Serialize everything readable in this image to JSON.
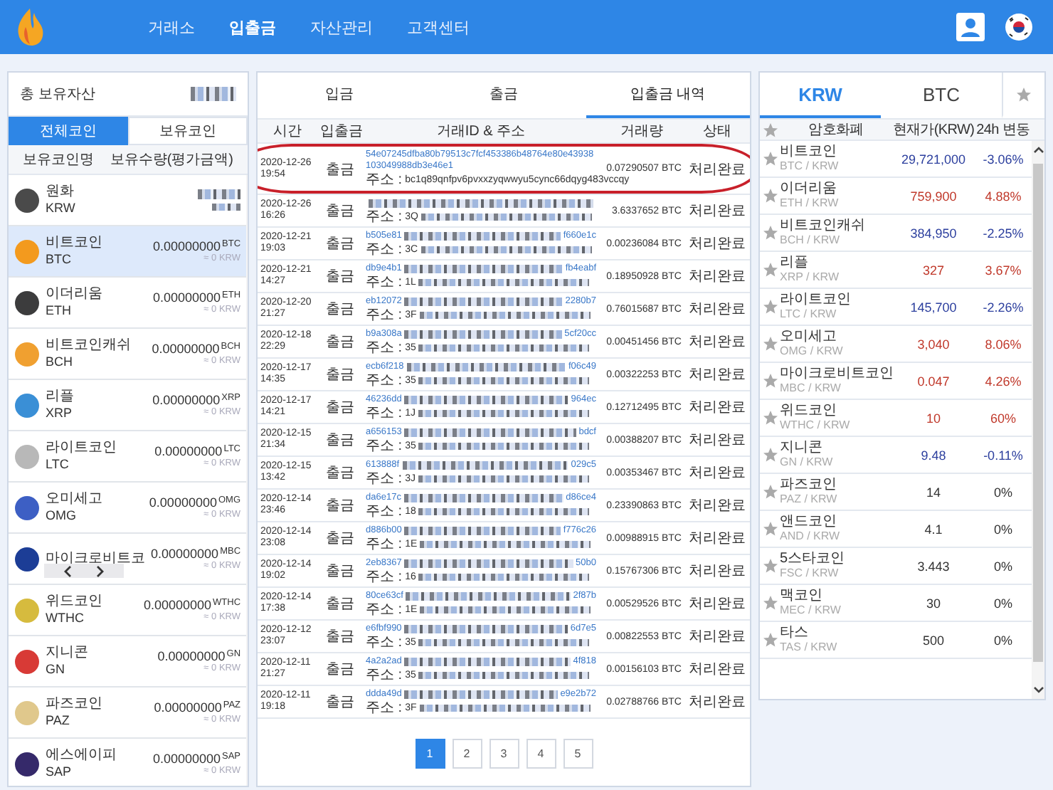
{
  "nav": {
    "items": [
      {
        "label": "거래소",
        "selected": false
      },
      {
        "label": "입출금",
        "selected": true
      },
      {
        "label": "자산관리",
        "selected": false
      },
      {
        "label": "고객센터",
        "selected": false
      }
    ]
  },
  "assets": {
    "title": "총 보유자산",
    "total_redacted": true,
    "tabs": [
      {
        "label": "전체코인",
        "selected": true
      },
      {
        "label": "보유코인",
        "selected": false
      }
    ],
    "columns": [
      "보유코인명",
      "보유수량(평가금액)"
    ],
    "coins": [
      {
        "name": "원화",
        "symbol": "KRW",
        "redacted": true,
        "selected": false,
        "color": "#4a4a4a"
      },
      {
        "name": "비트코인",
        "symbol": "BTC",
        "amount": "0.00000000",
        "unit": "BTC",
        "value": "≈ 0 KRW",
        "selected": true,
        "color": "#f39a1e"
      },
      {
        "name": "이더리움",
        "symbol": "ETH",
        "amount": "0.00000000",
        "unit": "ETH",
        "value": "≈ 0 KRW",
        "selected": false,
        "color": "#3c3c3d"
      },
      {
        "name": "비트코인캐쉬",
        "symbol": "BCH",
        "amount": "0.00000000",
        "unit": "BCH",
        "value": "≈ 0 KRW",
        "selected": false,
        "color": "#f0a030"
      },
      {
        "name": "리플",
        "symbol": "XRP",
        "amount": "0.00000000",
        "unit": "XRP",
        "value": "≈ 0 KRW",
        "selected": false,
        "color": "#3a8fd6"
      },
      {
        "name": "라이트코인",
        "symbol": "LTC",
        "amount": "0.00000000",
        "unit": "LTC",
        "value": "≈ 0 KRW",
        "selected": false,
        "color": "#b8b8b8"
      },
      {
        "name": "오미세고",
        "symbol": "OMG",
        "amount": "0.00000000",
        "unit": "OMG",
        "value": "≈ 0 KRW",
        "selected": false,
        "color": "#3d5fc4"
      },
      {
        "name": "마이크로비트코",
        "amount": "0.00000000",
        "unit": "MBC",
        "value": "≈ 0 KRW",
        "selected": false,
        "color": "#1c3d96",
        "popup": true
      },
      {
        "name": "위드코인",
        "symbol": "WTHC",
        "amount": "0.00000000",
        "unit": "WTHC",
        "value": "≈ 0 KRW",
        "selected": false,
        "color": "#d6bb3e"
      },
      {
        "name": "지니콘",
        "symbol": "GN",
        "amount": "0.00000000",
        "unit": "GN",
        "value": "≈ 0 KRW",
        "selected": false,
        "color": "#d83a36"
      },
      {
        "name": "파즈코인",
        "symbol": "PAZ",
        "amount": "0.00000000",
        "unit": "PAZ",
        "value": "≈ 0 KRW",
        "selected": false,
        "color": "#e0c88c"
      },
      {
        "name": "에스에이피",
        "symbol": "SAP",
        "amount": "0.00000000",
        "unit": "SAP",
        "value": "≈ 0 KRW",
        "selected": false,
        "color": "#35296a"
      }
    ]
  },
  "history": {
    "tabs": [
      {
        "label": "입금",
        "selected": false
      },
      {
        "label": "출금",
        "selected": false
      },
      {
        "label": "입출금 내역",
        "selected": true
      }
    ],
    "columns": [
      "시간",
      "입출금",
      "거래ID & 주소",
      "거래량",
      "상태"
    ],
    "rows": [
      {
        "date": "2020-12-26",
        "time": "19:54",
        "type": "출금",
        "txid": "54e07245dfba80b79513c7fcf453386b48764e80e43938103049988db3e46e1",
        "address_label": "주소 :",
        "address": "bc1q89qnfpv6pvxxzyqwwyu5cync66dqyg483vccqy",
        "amount": "0.07290507 BTC",
        "status": "처리완료",
        "redacted": false,
        "circled": true
      },
      {
        "date": "2020-12-26",
        "time": "16:26",
        "type": "출금",
        "address_label": "주소 :",
        "address": "3Q",
        "amount": "3.6337652 BTC",
        "status": "처리완료",
        "redacted": true,
        "circled": false
      },
      {
        "date": "2020-12-21",
        "time": "19:03",
        "type": "출금",
        "txid_start": "b505e81",
        "txid_end": "f660e1c",
        "address_label": "주소 :",
        "address": "3C",
        "amount": "0.00236084 BTC",
        "status": "처리완료",
        "redacted": true,
        "circled": false
      },
      {
        "date": "2020-12-21",
        "time": "14:27",
        "type": "출금",
        "txid_start": "db9e4b1",
        "txid_end": "fb4eabf",
        "address_label": "주소 :",
        "address": "1L",
        "amount": "0.18950928 BTC",
        "status": "처리완료",
        "redacted": true,
        "circled": false
      },
      {
        "date": "2020-12-20",
        "time": "21:27",
        "type": "출금",
        "txid_start": "eb12072",
        "txid_end": "2280b7",
        "address_label": "주소 :",
        "address": "3F",
        "amount": "0.76015687 BTC",
        "status": "처리완료",
        "redacted": true,
        "circled": false
      },
      {
        "date": "2020-12-18",
        "time": "22:29",
        "type": "출금",
        "txid_start": "b9a308a",
        "txid_end": "5cf20cc",
        "address_label": "주소 :",
        "address": "35",
        "amount": "0.00451456 BTC",
        "status": "처리완료",
        "redacted": true,
        "circled": false
      },
      {
        "date": "2020-12-17",
        "time": "14:35",
        "type": "출금",
        "txid_start": "ecb6f218",
        "txid_end": "f06c49",
        "address_label": "주소 :",
        "address": "35",
        "amount": "0.00322253 BTC",
        "status": "처리완료",
        "redacted": true,
        "circled": false
      },
      {
        "date": "2020-12-17",
        "time": "14:21",
        "type": "출금",
        "txid_start": "46236dd",
        "txid_end": "964ec",
        "address_label": "주소 :",
        "address": "1J",
        "amount": "0.12712495 BTC",
        "status": "처리완료",
        "redacted": true,
        "circled": false
      },
      {
        "date": "2020-12-15",
        "time": "21:34",
        "type": "출금",
        "txid_start": "a656153",
        "txid_end": "bdcf",
        "address_label": "주소 :",
        "address": "35",
        "amount": "0.00388207 BTC",
        "status": "처리완료",
        "redacted": true,
        "circled": false
      },
      {
        "date": "2020-12-15",
        "time": "13:42",
        "type": "출금",
        "txid_start": "613888f",
        "txid_end": "029c5",
        "address_label": "주소 :",
        "address": "3J",
        "amount": "0.00353467 BTC",
        "status": "처리완료",
        "redacted": true,
        "circled": false
      },
      {
        "date": "2020-12-14",
        "time": "23:46",
        "type": "출금",
        "txid_start": "da6e17c",
        "txid_end": "d86ce4",
        "address_label": "주소 :",
        "address": "18",
        "amount": "0.23390863 BTC",
        "status": "처리완료",
        "redacted": true,
        "circled": false
      },
      {
        "date": "2020-12-14",
        "time": "23:08",
        "type": "출금",
        "txid_start": "d886b00",
        "txid_end": "f776c26",
        "address_label": "주소 :",
        "address": "1E",
        "amount": "0.00988915 BTC",
        "status": "처리완료",
        "redacted": true,
        "circled": false
      },
      {
        "date": "2020-12-14",
        "time": "19:02",
        "type": "출금",
        "txid_start": "2eb8367",
        "txid_end": "50b0",
        "address_label": "주소 :",
        "address": "16",
        "amount": "0.15767306 BTC",
        "status": "처리완료",
        "redacted": true,
        "circled": false
      },
      {
        "date": "2020-12-14",
        "time": "17:38",
        "type": "출금",
        "txid_start": "80ce63cf",
        "txid_end": "2f87b",
        "address_label": "주소 :",
        "address": "1E",
        "amount": "0.00529526 BTC",
        "status": "처리완료",
        "redacted": true,
        "circled": false
      },
      {
        "date": "2020-12-12",
        "time": "23:07",
        "type": "출금",
        "txid_start": "e6fbf990",
        "txid_end": "6d7e5",
        "address_label": "주소 :",
        "address": "35",
        "amount": "0.00822553 BTC",
        "status": "처리완료",
        "redacted": true,
        "circled": false
      },
      {
        "date": "2020-12-11",
        "time": "21:27",
        "type": "출금",
        "txid_start": "4a2a2ad",
        "txid_end": "4f818",
        "address_label": "주소 :",
        "address": "35",
        "amount": "0.00156103 BTC",
        "status": "처리완료",
        "redacted": true,
        "circled": false
      },
      {
        "date": "2020-12-11",
        "time": "19:18",
        "type": "출금",
        "txid_start": "ddda49d",
        "txid_end": "e9e2b72",
        "address_label": "주소 :",
        "address": "3F",
        "amount": "0.02788766 BTC",
        "status": "처리완료",
        "redacted": true,
        "circled": false
      }
    ],
    "pages": [
      {
        "label": "1",
        "selected": true
      },
      {
        "label": "2",
        "selected": false
      },
      {
        "label": "3",
        "selected": false
      },
      {
        "label": "4",
        "selected": false
      },
      {
        "label": "5",
        "selected": false
      }
    ]
  },
  "market": {
    "tabs": [
      {
        "kind": "text",
        "label": "KRW",
        "selected": true
      },
      {
        "kind": "text",
        "label": "BTC",
        "selected": false
      },
      {
        "kind": "star",
        "selected": false
      }
    ],
    "columns": [
      "암호화폐",
      "현재가(KRW)",
      "24h 변동"
    ],
    "rows": [
      {
        "name": "비트코인",
        "pair": "BTC / KRW",
        "price": "29,721,000",
        "change": "-3.06%",
        "kind": "down",
        "favorite": false
      },
      {
        "name": "이더리움",
        "pair": "ETH / KRW",
        "price": "759,900",
        "change": "4.88%",
        "kind": "up",
        "favorite": false
      },
      {
        "name": "비트코인캐쉬",
        "pair": "BCH / KRW",
        "price": "384,950",
        "change": "-2.25%",
        "kind": "down",
        "favorite": false
      },
      {
        "name": "리플",
        "pair": "XRP / KRW",
        "price": "327",
        "change": "3.67%",
        "kind": "up",
        "favorite": false
      },
      {
        "name": "라이트코인",
        "pair": "LTC / KRW",
        "price": "145,700",
        "change": "-2.26%",
        "kind": "down",
        "favorite": false
      },
      {
        "name": "오미세고",
        "pair": "OMG / KRW",
        "price": "3,040",
        "change": "8.06%",
        "kind": "up",
        "favorite": false
      },
      {
        "name": "마이크로비트코인",
        "pair": "MBC / KRW",
        "price": "0.047",
        "change": "4.26%",
        "kind": "up",
        "favorite": false
      },
      {
        "name": "위드코인",
        "pair": "WTHC / KRW",
        "price": "10",
        "change": "60%",
        "kind": "up",
        "favorite": false
      },
      {
        "name": "지니콘",
        "pair": "GN / KRW",
        "price": "9.48",
        "change": "-0.11%",
        "kind": "down",
        "favorite": false
      },
      {
        "name": "파즈코인",
        "pair": "PAZ / KRW",
        "price": "14",
        "change": "0%",
        "kind": "flat",
        "favorite": false
      },
      {
        "name": "앤드코인",
        "pair": "AND / KRW",
        "price": "4.1",
        "change": "0%",
        "kind": "flat",
        "favorite": false
      },
      {
        "name": "5스타코인",
        "pair": "FSC / KRW",
        "price": "3.443",
        "change": "0%",
        "kind": "flat",
        "favorite": false
      },
      {
        "name": "맥코인",
        "pair": "MEC / KRW",
        "price": "30",
        "change": "0%",
        "kind": "flat",
        "favorite": false
      },
      {
        "name": "타스",
        "pair": "TAS / KRW",
        "price": "500",
        "change": "0%",
        "kind": "flat",
        "favorite": false
      }
    ]
  }
}
